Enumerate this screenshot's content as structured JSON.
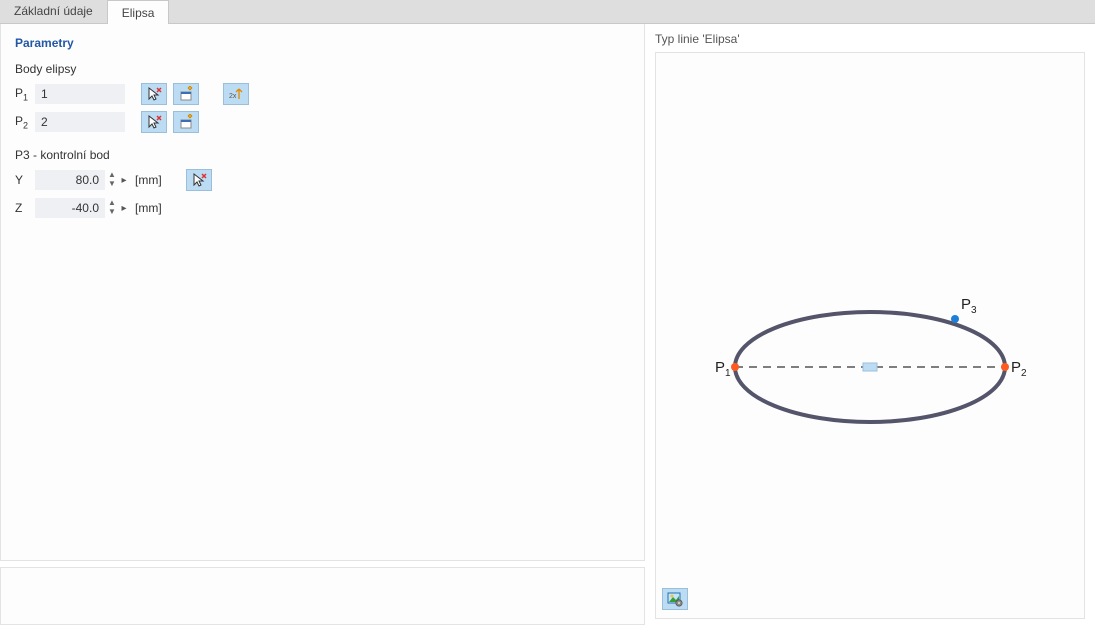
{
  "tabs": {
    "basic": "Základní údaje",
    "ellipse": "Elipsa"
  },
  "section_title": "Parametry",
  "body_title": "Body elipsy",
  "p1_label": "P",
  "p1_sub": "1",
  "p2_label": "P",
  "p2_sub": "2",
  "p1_value": "1",
  "p2_value": "2",
  "control_title": "P3 - kontrolní bod",
  "y_label": "Y",
  "z_label": "Z",
  "y_value": "80.0",
  "z_value": "-40.0",
  "unit": "[mm]",
  "preview_title": "Typ linie 'Elipsa'",
  "pt_labels": {
    "p1": "P",
    "p1s": "1",
    "p2": "P",
    "p2s": "2",
    "p3": "P",
    "p3s": "3"
  }
}
